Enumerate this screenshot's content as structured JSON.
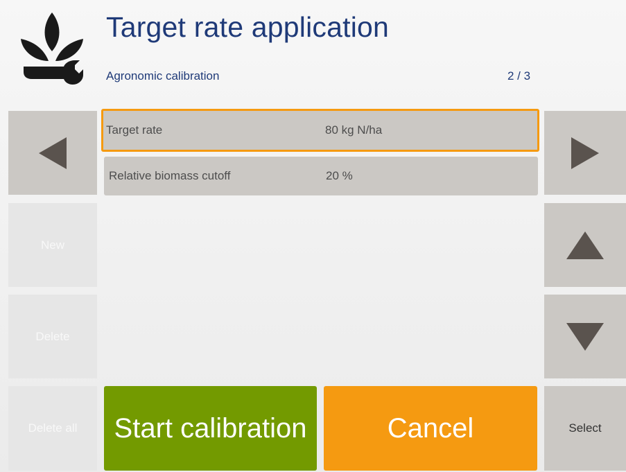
{
  "header": {
    "title": "Target rate application",
    "subtitle": "Agronomic calibration",
    "page_indicator": "2 / 3",
    "logo_icon": "plant-wrench-icon"
  },
  "left_buttons": {
    "back_icon": "arrow-left-icon",
    "new_label": "New",
    "delete_label": "Delete",
    "delete_all_label": "Delete all"
  },
  "right_buttons": {
    "forward_icon": "arrow-right-icon",
    "up_icon": "arrow-up-icon",
    "down_icon": "arrow-down-icon",
    "select_label": "Select"
  },
  "list": {
    "rows": [
      {
        "label": "Target rate",
        "value": "80 kg N/ha",
        "selected": true
      },
      {
        "label": "Relative biomass cutoff",
        "value": "20 %",
        "selected": false
      }
    ]
  },
  "actions": {
    "start_label": "Start calibration",
    "cancel_label": "Cancel"
  },
  "colors": {
    "accent_orange": "#f59a11",
    "start_green": "#739a00",
    "title_blue": "#1f3a78",
    "button_grey": "#cbc8c4",
    "arrow_dark": "#5a534e"
  }
}
